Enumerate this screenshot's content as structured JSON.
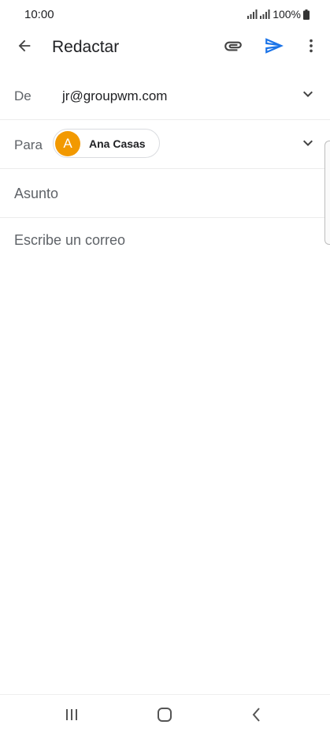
{
  "status_bar": {
    "time": "10:00",
    "battery": "100%",
    "icons": [
      "signal-icon",
      "signal-icon",
      "battery-icon"
    ]
  },
  "app_bar": {
    "title": "Redactar",
    "icons": {
      "back": "arrow-left-icon",
      "attach": "paperclip-icon",
      "send": "send-icon",
      "more": "more-vert-icon"
    },
    "accent_color": "#1a73e8"
  },
  "compose": {
    "from": {
      "label": "De",
      "value": "jr@groupwm.com"
    },
    "to": {
      "label": "Para",
      "recipient": {
        "initial": "A",
        "name": "Ana Casas",
        "avatar_color": "#f29900"
      }
    },
    "subject": {
      "placeholder": "Asunto",
      "value": ""
    },
    "body": {
      "placeholder": "Escribe un correo",
      "value": ""
    }
  },
  "nav_bar": {
    "icons": [
      "recents-icon",
      "home-icon",
      "back-icon"
    ]
  }
}
